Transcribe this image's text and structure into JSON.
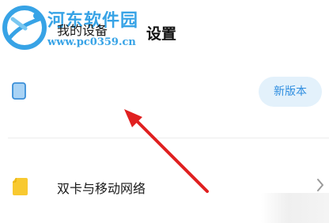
{
  "header": {
    "title": "设置"
  },
  "watermark": {
    "name": "河东软件园",
    "url": "www.pc0359.cn"
  },
  "device_row": {
    "label": "我的设备",
    "badge": "新版本",
    "icon": "phone-icon"
  },
  "sim_row": {
    "label": "双卡与移动网络",
    "icon": "sim-card-icon"
  },
  "colors": {
    "accent": "#2f8ee0",
    "badge_bg": "#e3f1fb",
    "arrow": "#e02020",
    "watermark": "#37a3e6"
  }
}
